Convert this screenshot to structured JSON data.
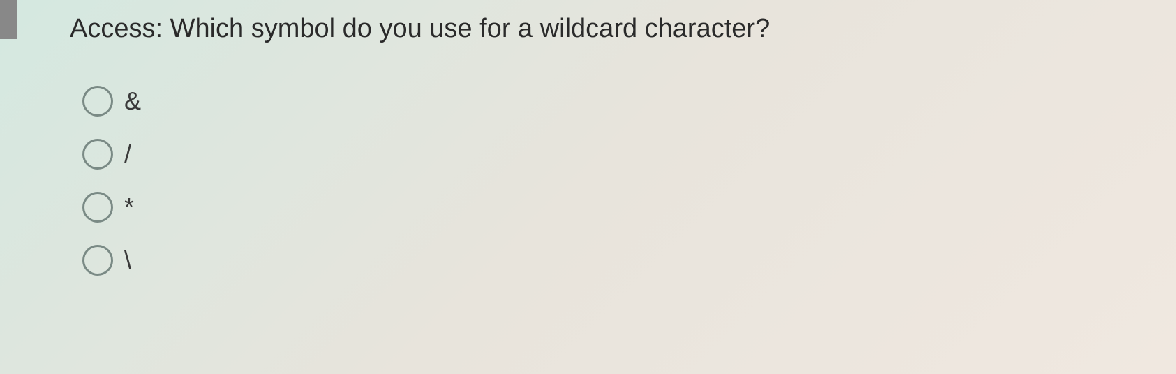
{
  "question": {
    "text": "Access: Which symbol do you use for a wildcard character?"
  },
  "options": [
    {
      "label": "&"
    },
    {
      "label": "/"
    },
    {
      "label": "*"
    },
    {
      "label": "\\"
    }
  ]
}
